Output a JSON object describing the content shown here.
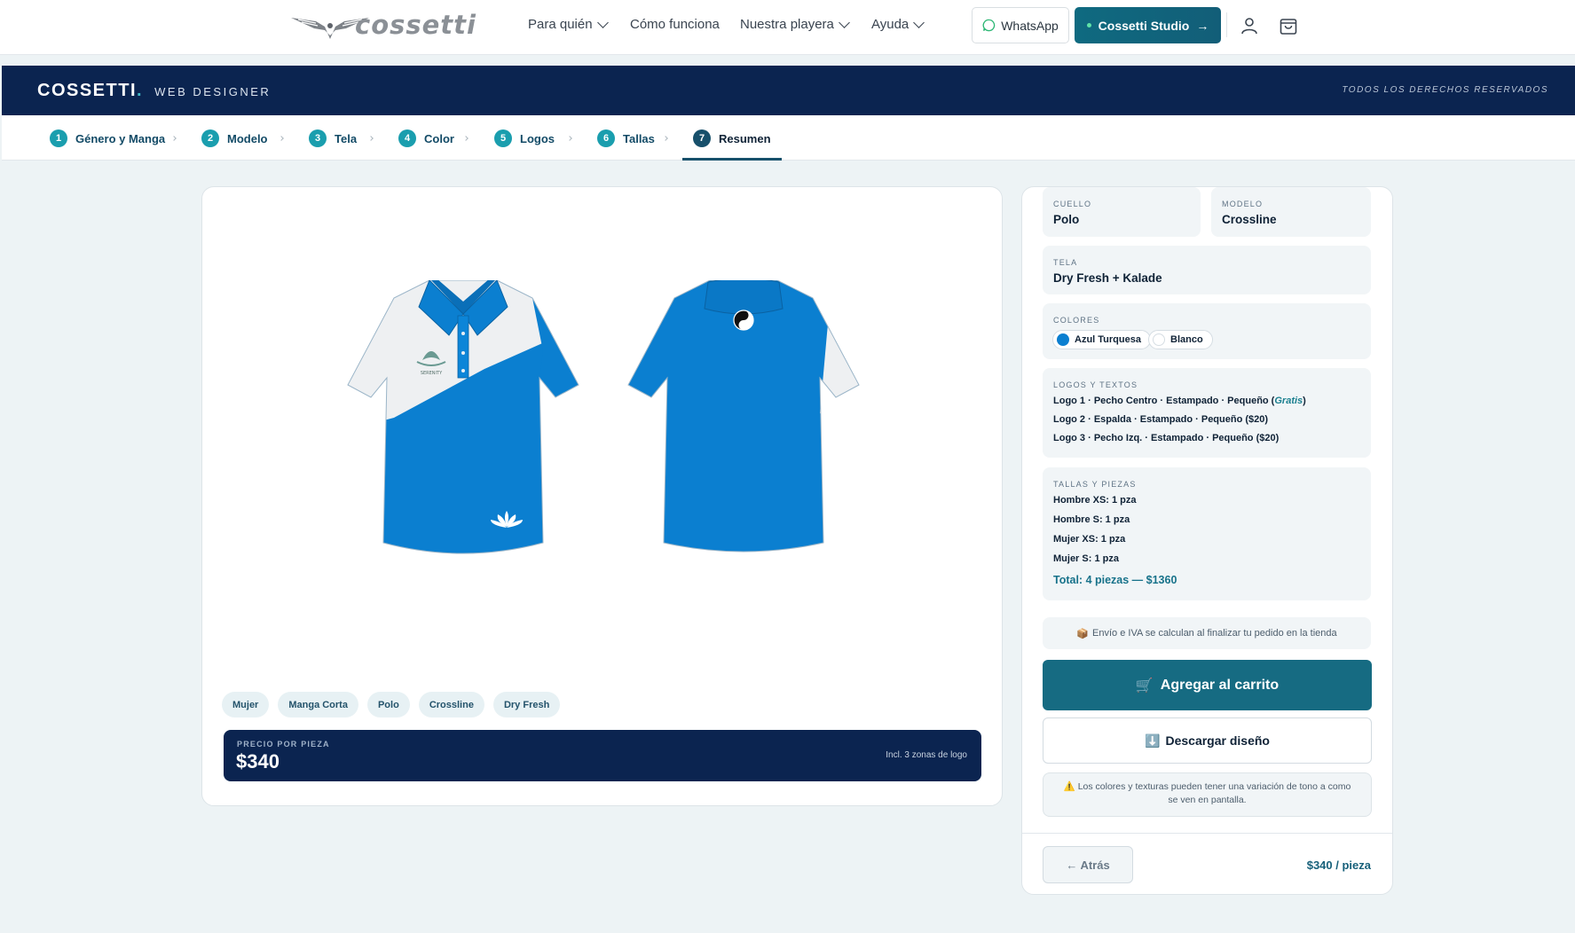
{
  "brand": {
    "name": "cossetti"
  },
  "nav": {
    "items": [
      {
        "label": "Para quién",
        "dropdown": true
      },
      {
        "label": "Cómo funciona",
        "dropdown": false
      },
      {
        "label": "Nuestra playera",
        "dropdown": true
      },
      {
        "label": "Ayuda",
        "dropdown": true
      }
    ],
    "whatsapp_label": "WhatsApp",
    "studio_label": "Cossetti Studio"
  },
  "header": {
    "title": "COSSETTI",
    "dot": ".",
    "subtitle": "WEB DESIGNER",
    "rights": "TODOS LOS DERECHOS RESERVADOS"
  },
  "steps": [
    {
      "num": "1",
      "label": "Género y Manga"
    },
    {
      "num": "2",
      "label": "Modelo"
    },
    {
      "num": "3",
      "label": "Tela"
    },
    {
      "num": "4",
      "label": "Color"
    },
    {
      "num": "5",
      "label": "Logos"
    },
    {
      "num": "6",
      "label": "Tallas"
    },
    {
      "num": "7",
      "label": "Resumen",
      "active": true
    }
  ],
  "preview": {
    "tags": [
      "Mujer",
      "Manga Corta",
      "Polo",
      "Crossline",
      "Dry Fresh"
    ],
    "price_label": "PRECIO POR PIEZA",
    "price_value": "$340",
    "price_note": "Incl. 3 zonas de logo",
    "shirt_colors": {
      "primary": "#0b7fd0",
      "secondary": "#eef0f2"
    },
    "logo_front_text": "SERENITY"
  },
  "summary": {
    "cuello": {
      "label": "CUELLO",
      "value": "Polo"
    },
    "modelo": {
      "label": "MODELO",
      "value": "Crossline"
    },
    "tela": {
      "label": "TELA",
      "value": "Dry Fresh + Kalade"
    },
    "colores": {
      "label": "COLORES",
      "items": [
        {
          "name": "Azul Turquesa",
          "hex": "#0b7fd0"
        },
        {
          "name": "Blanco",
          "hex": "#ffffff"
        }
      ]
    },
    "logos": {
      "label": "LOGOS Y TEXTOS",
      "items": [
        {
          "text": "Logo 1 · Pecho Centro · Estampado · Pequeño (",
          "free": "Gratis",
          "end": ")"
        },
        {
          "text": "Logo 2 · Espalda · Estampado · Pequeño ($20)"
        },
        {
          "text": "Logo 3 · Pecho Izq. · Estampado · Pequeño ($20)"
        }
      ]
    },
    "tallas": {
      "label": "TALLAS Y PIEZAS",
      "items": [
        "Hombre XS: 1 pza",
        "Hombre S: 1 pza",
        "Mujer XS: 1 pza",
        "Mujer S: 1 pza"
      ],
      "total": "Total: 4 piezas — $1360"
    },
    "shipping_note": "Envío e IVA se calculan al finalizar tu pedido en la tienda",
    "cart_label": "Agregar al carrito",
    "download_label": "Descargar diseño",
    "warning": "Los colores y texturas pueden tener una variación de tono a como se ven en pantalla.",
    "back_label": "← Atrás",
    "unit_price": "$340 / pieza"
  }
}
